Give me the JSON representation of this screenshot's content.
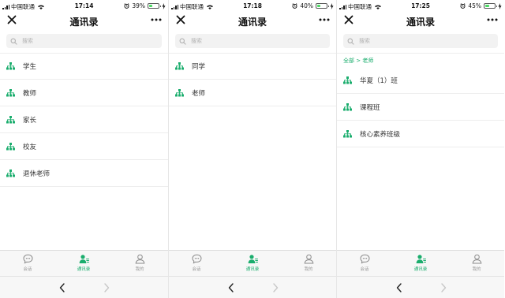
{
  "colors": {
    "accent": "#1aad6d",
    "battery_fill": "#4cd964"
  },
  "screens": [
    {
      "status": {
        "carrier": "中国联通",
        "time": "17:14",
        "battery": "39%",
        "battery_level": 0.39
      },
      "nav": {
        "title": "通讯录"
      },
      "search": {
        "placeholder": "搜索"
      },
      "breadcrumb": null,
      "items": [
        {
          "label": "学生",
          "icon": "org-tree-icon"
        },
        {
          "label": "教师",
          "icon": "org-tree-icon"
        },
        {
          "label": "家长",
          "icon": "org-tree-icon"
        },
        {
          "label": "校友",
          "icon": "org-tree-icon"
        },
        {
          "label": "退休老师",
          "icon": "org-tree-icon"
        }
      ],
      "tabs": [
        {
          "label": "会话",
          "icon": "chat-icon",
          "active": false
        },
        {
          "label": "通讯录",
          "icon": "contacts-icon",
          "active": true
        },
        {
          "label": "我的",
          "icon": "profile-icon",
          "active": false
        }
      ]
    },
    {
      "status": {
        "carrier": "中国联通",
        "time": "17:18",
        "battery": "40%",
        "battery_level": 0.4
      },
      "nav": {
        "title": "通讯录"
      },
      "search": {
        "placeholder": "搜索"
      },
      "breadcrumb": null,
      "items": [
        {
          "label": "同学",
          "icon": "org-tree-icon"
        },
        {
          "label": "老师",
          "icon": "org-tree-icon"
        }
      ],
      "tabs": [
        {
          "label": "会话",
          "icon": "chat-icon",
          "active": false
        },
        {
          "label": "通讯录",
          "icon": "contacts-icon",
          "active": true
        },
        {
          "label": "我的",
          "icon": "profile-icon",
          "active": false
        }
      ]
    },
    {
      "status": {
        "carrier": "中国联通",
        "time": "17:25",
        "battery": "45%",
        "battery_level": 0.45
      },
      "nav": {
        "title": "通讯录"
      },
      "search": {
        "placeholder": "搜索"
      },
      "breadcrumb": "全部 > 老师",
      "items": [
        {
          "label": "华夏（1）班",
          "icon": "org-tree-icon"
        },
        {
          "label": "课程班",
          "icon": "org-tree-icon"
        },
        {
          "label": "核心素养班级",
          "icon": "org-tree-icon"
        }
      ],
      "tabs": [
        {
          "label": "会话",
          "icon": "chat-icon",
          "active": false
        },
        {
          "label": "通讯录",
          "icon": "contacts-icon",
          "active": true
        },
        {
          "label": "我的",
          "icon": "profile-icon",
          "active": false
        }
      ]
    }
  ]
}
